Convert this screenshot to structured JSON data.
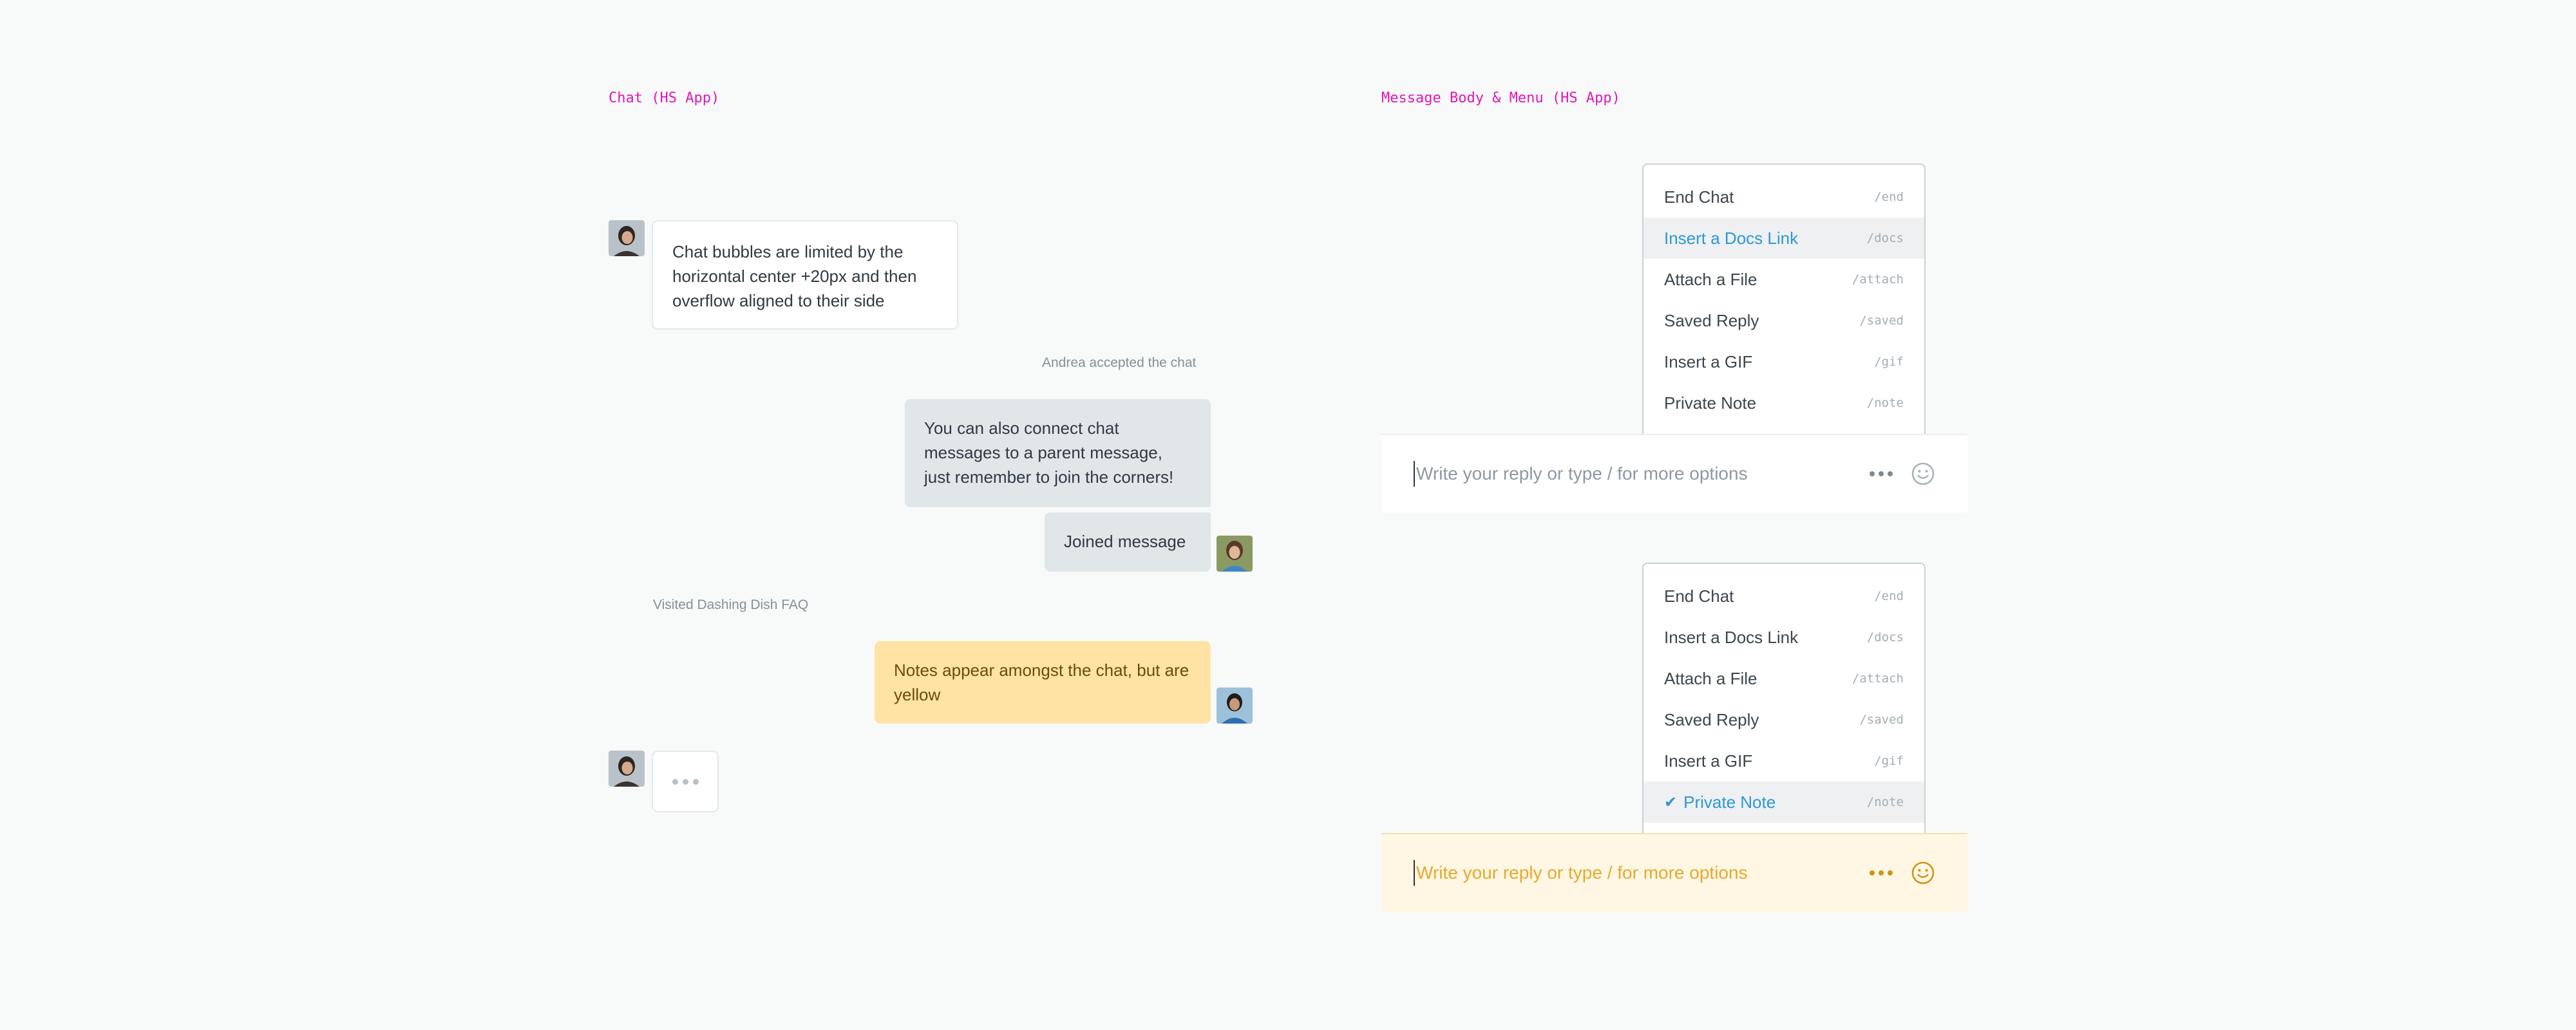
{
  "titles": {
    "chat": "Chat (HS App)",
    "message_body": "Message Body & Menu (HS App)"
  },
  "chat": {
    "customer_message": "Chat bubbles are limited by the horizontal center +20px and then overflow aligned to their side",
    "event_accepted": "Andrea accepted the chat",
    "agent_message": "You can also connect chat messages to a parent message, just remember to join the corners!",
    "agent_joined_message": "Joined message",
    "event_visited": "Visited Dashing Dish FAQ",
    "note_message": "Notes appear amongst the chat, but are yellow"
  },
  "menu_top": {
    "items": [
      {
        "label": "End Chat",
        "command": "/end"
      },
      {
        "label": "Insert a Docs Link",
        "command": "/docs"
      },
      {
        "label": "Attach a File",
        "command": "/attach"
      },
      {
        "label": "Saved Reply",
        "command": "/saved"
      },
      {
        "label": "Insert a GIF",
        "command": "/gif"
      },
      {
        "label": "Private Note",
        "command": "/note"
      }
    ],
    "hovered_index": 1
  },
  "menu_bottom": {
    "items": [
      {
        "label": "End Chat",
        "command": "/end"
      },
      {
        "label": "Insert a Docs Link",
        "command": "/docs"
      },
      {
        "label": "Attach a File",
        "command": "/attach"
      },
      {
        "label": "Saved Reply",
        "command": "/saved"
      },
      {
        "label": "Insert a GIF",
        "command": "/gif"
      },
      {
        "label": "Private Note",
        "command": "/note"
      }
    ],
    "selected_index": 5
  },
  "composer": {
    "placeholder": "Write your reply or type / for more options"
  },
  "icons": {
    "more": "more-dots-icon",
    "emoji": "emoji-icon",
    "check": "checkmark-icon"
  },
  "colors": {
    "section_title": "#e018b7",
    "link_blue": "#2e97d6",
    "note_yellow": "#ffe3a4",
    "note_composer": "#fff7e3",
    "note_accent": "#d09219"
  }
}
